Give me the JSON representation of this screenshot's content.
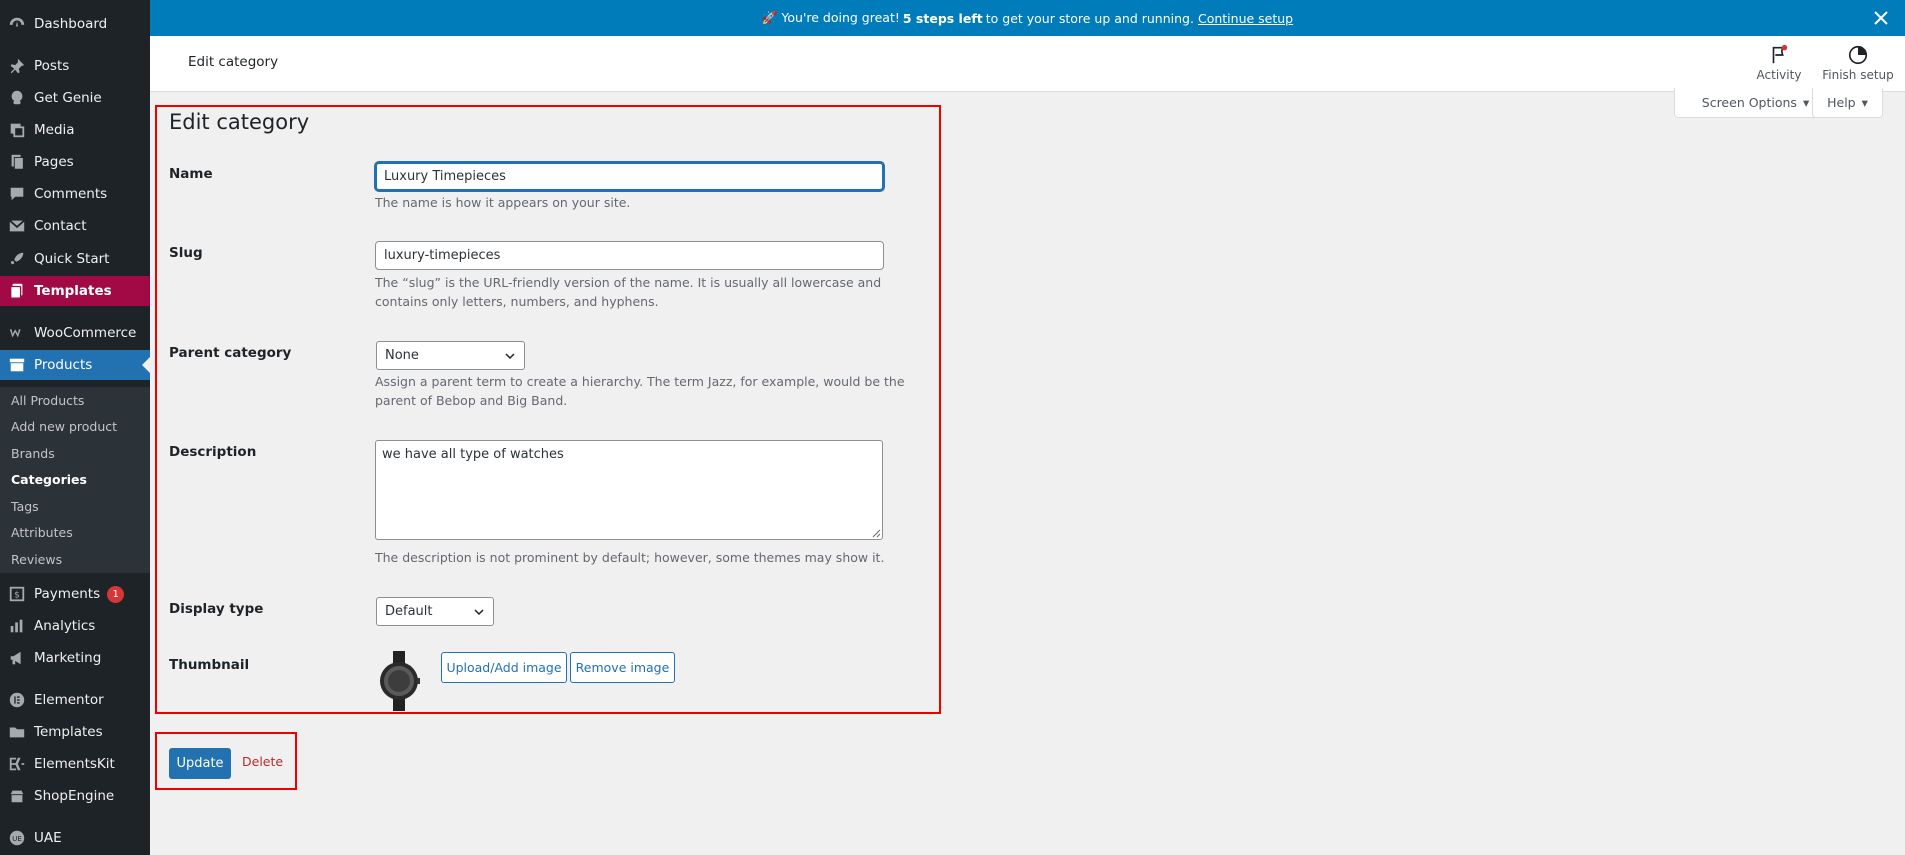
{
  "sidebar": {
    "items": [
      {
        "label": "Dashboard",
        "icon": "dashboard-icon"
      },
      {
        "label": "Posts",
        "icon": "pin-icon"
      },
      {
        "label": "Get Genie",
        "icon": "genie-icon"
      },
      {
        "label": "Media",
        "icon": "media-icon"
      },
      {
        "label": "Pages",
        "icon": "pages-icon"
      },
      {
        "label": "Comments",
        "icon": "comment-icon"
      },
      {
        "label": "Contact",
        "icon": "mail-icon"
      },
      {
        "label": "Quick Start",
        "icon": "rocket-icon"
      },
      {
        "label": "Templates",
        "icon": "templates-icon"
      },
      {
        "label": "WooCommerce",
        "icon": "woo-icon"
      },
      {
        "label": "Products",
        "icon": "archive-icon"
      },
      {
        "label": "Payments",
        "icon": "dollar-icon",
        "badge": "1"
      },
      {
        "label": "Analytics",
        "icon": "bar-chart-icon"
      },
      {
        "label": "Marketing",
        "icon": "megaphone-icon"
      },
      {
        "label": "Elementor",
        "icon": "elementor-icon"
      },
      {
        "label": "Templates",
        "icon": "folder-icon"
      },
      {
        "label": "ElementsKit",
        "icon": "ekit-icon"
      },
      {
        "label": "ShopEngine",
        "icon": "shop-icon"
      },
      {
        "label": "UAE",
        "icon": "uae-icon"
      }
    ],
    "submenu": [
      "All Products",
      "Add new product",
      "Brands",
      "Categories",
      "Tags",
      "Attributes",
      "Reviews"
    ]
  },
  "banner": {
    "text_before": "🚀 You're doing great!",
    "text_bold": "5 steps left",
    "text_after": "to get your store up and running.",
    "link": "Continue setup"
  },
  "header": {
    "title": "Edit category",
    "activity": "Activity",
    "finish_setup": "Finish setup"
  },
  "screen_options": {
    "screen_options_label": "Screen Options",
    "help_label": "Help"
  },
  "form": {
    "heading": "Edit category",
    "name_label": "Name",
    "name_value": "Luxury Timepieces",
    "name_desc": "The name is how it appears on your site.",
    "slug_label": "Slug",
    "slug_value": "luxury-timepieces",
    "slug_desc_1": "The “slug” is the URL-friendly version of the name. It is usually all lowercase and",
    "slug_desc_2": "contains only letters, numbers, and hyphens.",
    "parent_label": "Parent category",
    "parent_value": "None",
    "parent_desc_1": "Assign a parent term to create a hierarchy. The term Jazz, for example, would be the",
    "parent_desc_2": "parent of Bebop and Big Band.",
    "description_label": "Description",
    "description_value": "we have all type of watches",
    "description_desc": "The description is not prominent by default; however, some themes may show it.",
    "display_label": "Display type",
    "display_value": "Default",
    "thumbnail_label": "Thumbnail",
    "upload_label": "Upload/Add image",
    "remove_label": "Remove image"
  },
  "actions": {
    "update_label": "Update",
    "delete_label": "Delete"
  },
  "colors": {
    "sidebar_bg": "#1d2327",
    "templates_active": "#a10a45",
    "products_active": "#2271b1",
    "banner": "#007cba",
    "highlight_box": "#ee0000"
  }
}
